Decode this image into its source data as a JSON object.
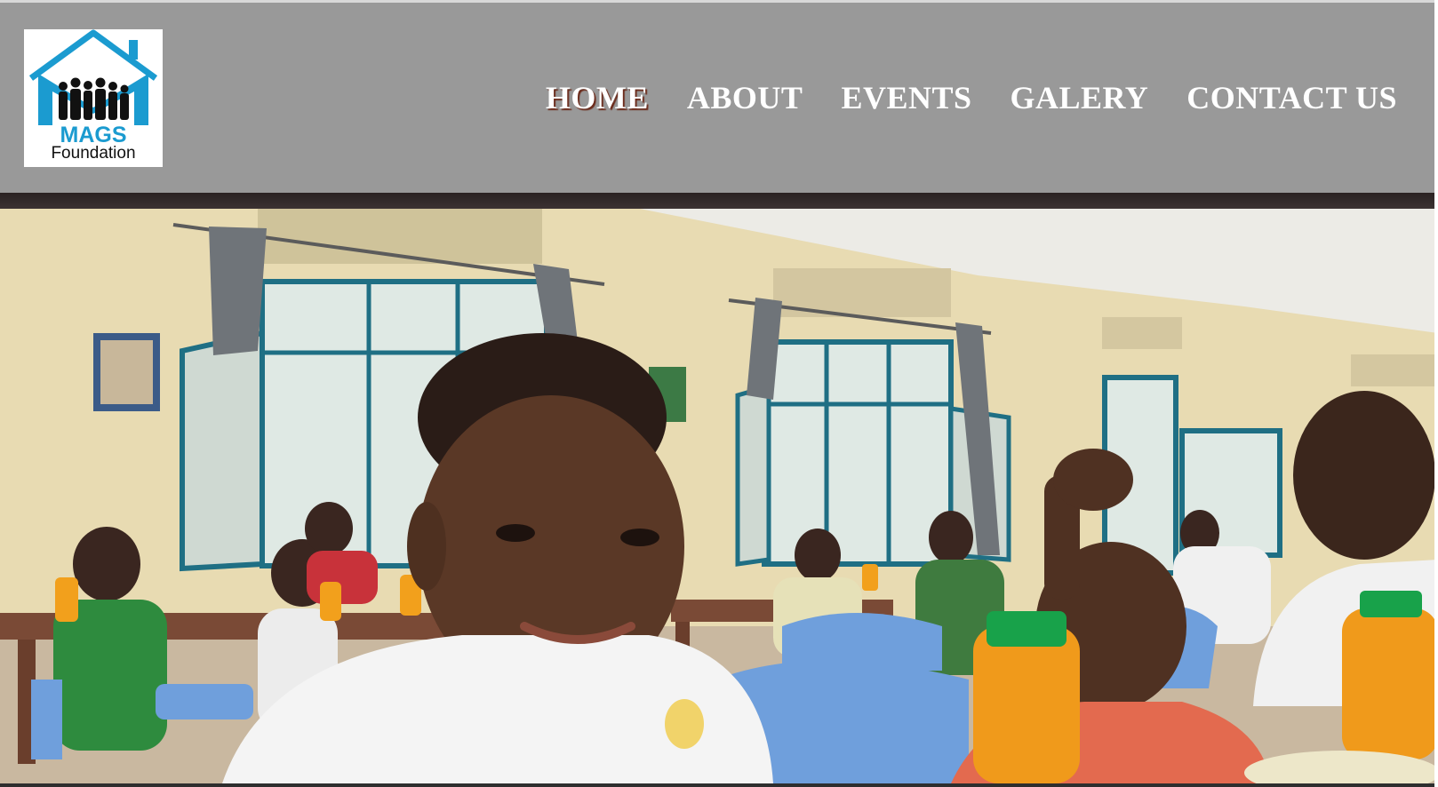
{
  "brand": {
    "name": "MAGS",
    "subtitle": "Foundation",
    "logo_icon": "house-with-family-icon",
    "color_primary": "#1b9bd0"
  },
  "nav": {
    "items": [
      {
        "label": "HOME",
        "active": true
      },
      {
        "label": "ABOUT",
        "active": false
      },
      {
        "label": "EVENTS",
        "active": false
      },
      {
        "label": "GALERY",
        "active": false
      },
      {
        "label": "CONTACT US",
        "active": false
      }
    ]
  },
  "colors": {
    "header_bg": "#999999",
    "nav_text": "#ffffff",
    "active_shadow": "#6b2a1a"
  }
}
